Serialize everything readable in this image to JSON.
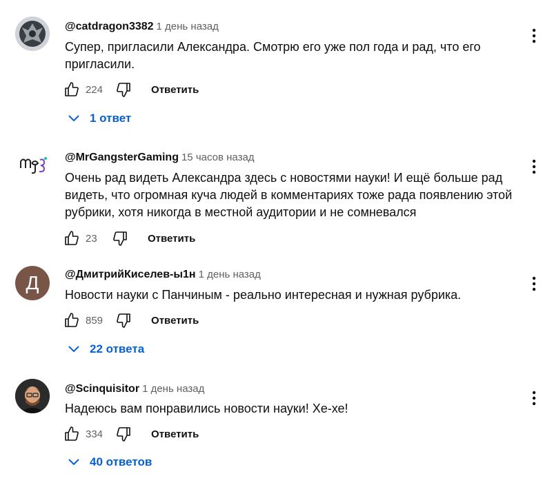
{
  "comments": [
    {
      "handle": "@catdragon3382",
      "time": "1 день назад",
      "text": "Супер, пригласили Александра. Смотрю его уже пол года и рад, что его пригласили.",
      "likes": "224",
      "reply_label": "Ответить",
      "replies_label": "1 ответ",
      "avatar": {
        "type": "dark-emblem",
        "bg": "#d9dce1"
      }
    },
    {
      "handle": "@MrGangsterGaming",
      "time": "15 часов назад",
      "text": "Очень рад видеть Александра здесь с новостями науки! И ещё больше рад видеть, что огромная куча людей в комментариях тоже рада появлению этой рубрики, хотя никогда в местной аудитории и не сомневался",
      "likes": "23",
      "reply_label": "Ответить",
      "avatar": {
        "type": "logo",
        "bg": "#ffffff"
      }
    },
    {
      "handle": "@ДмитрийКиселев-ы1н",
      "time": "1 день назад",
      "text": "Новости науки с Панчиным - реально интересная и нужная рубрика.",
      "likes": "859",
      "reply_label": "Ответить",
      "replies_label": "22 ответа",
      "avatar": {
        "type": "letter",
        "letter": "Д",
        "bg": "#795548"
      }
    },
    {
      "handle": "@Scinquisitor",
      "time": "1 день назад",
      "text": "Надеюсь вам понравились новости науки! Хе-хе!",
      "likes": "334",
      "reply_label": "Ответить",
      "replies_label": "40 ответов",
      "avatar": {
        "type": "photo",
        "bg": "#2b2b2b"
      }
    }
  ],
  "colors": {
    "link": "#065fd4",
    "secondary": "#606060",
    "text": "#0f0f0f"
  },
  "icons": [
    "like-icon",
    "dislike-icon",
    "chevron-down-icon",
    "more-vert-icon"
  ]
}
